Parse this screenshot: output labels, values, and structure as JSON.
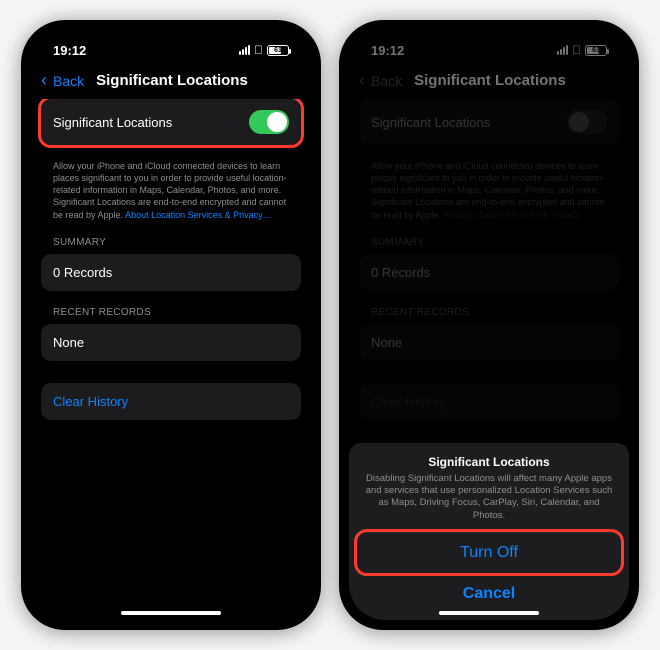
{
  "statusbar": {
    "time": "19:12",
    "battery": "61"
  },
  "nav": {
    "back": "Back",
    "title": "Significant Locations"
  },
  "toggle_row": {
    "label": "Significant Locations"
  },
  "footer": {
    "text": "Allow your iPhone and iCloud connected devices to learn places significant to you in order to provide useful location-related information in Maps, Calendar, Photos, and more. Significant Locations are end-to-end encrypted and cannot be read by Apple.",
    "link": "About Location Services & Privacy…"
  },
  "summary": {
    "header": "SUMMARY",
    "value": "0 Records"
  },
  "recent": {
    "header": "RECENT RECORDS",
    "value": "None"
  },
  "clear_history": "Clear History",
  "sheet": {
    "title": "Significant Locations",
    "message": "Disabling Significant Locations will affect many Apple apps and services that use personalized Location Services such as Maps, Driving Focus, CarPlay, Siri, Calendar, and Photos.",
    "turn_off": "Turn Off",
    "cancel": "Cancel"
  }
}
